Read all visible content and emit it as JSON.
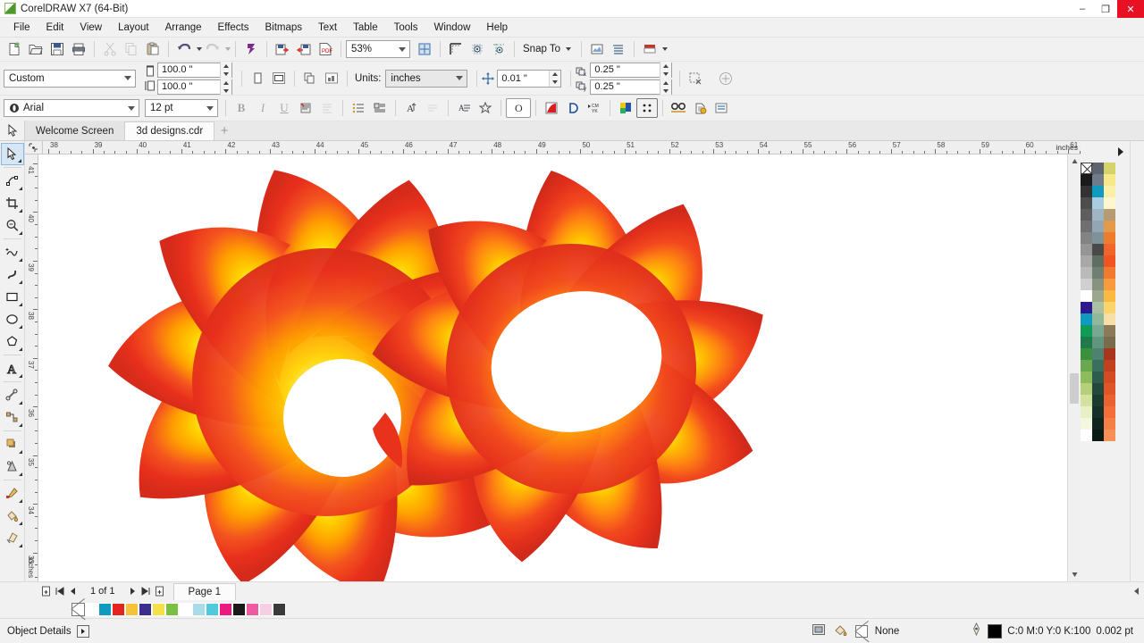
{
  "window": {
    "title": "CorelDRAW X7 (64-Bit)",
    "app_icon": "coreldraw-icon",
    "minimize": "–",
    "maximize": "❐",
    "close": "✕"
  },
  "menubar": {
    "items": [
      {
        "label": "File"
      },
      {
        "label": "Edit"
      },
      {
        "label": "View"
      },
      {
        "label": "Layout"
      },
      {
        "label": "Arrange"
      },
      {
        "label": "Effects"
      },
      {
        "label": "Bitmaps"
      },
      {
        "label": "Text"
      },
      {
        "label": "Table"
      },
      {
        "label": "Tools"
      },
      {
        "label": "Window"
      },
      {
        "label": "Help"
      }
    ]
  },
  "standard_toolbar": {
    "buttons": [
      {
        "name": "new-document",
        "title": "New"
      },
      {
        "name": "open-document",
        "title": "Open"
      },
      {
        "name": "save-document",
        "title": "Save"
      },
      {
        "name": "print-document",
        "title": "Print"
      },
      {
        "name": "cut",
        "title": "Cut"
      },
      {
        "name": "copy",
        "title": "Copy"
      },
      {
        "name": "paste",
        "title": "Paste"
      },
      {
        "name": "undo",
        "title": "Undo"
      },
      {
        "name": "redo",
        "title": "Redo"
      },
      {
        "name": "import",
        "title": "Import"
      },
      {
        "name": "export",
        "title": "Export"
      },
      {
        "name": "publish-pdf",
        "title": "Publish to PDF"
      }
    ],
    "zoom_level": "53%",
    "snap_to_label": "Snap To",
    "full_screen": "Full-Screen Preview"
  },
  "property_bar": {
    "page_preset": "Custom",
    "page_width": "100.0 \"",
    "page_height": "100.0 \"",
    "units_label": "Units:",
    "units_value": "inches",
    "nudge_offset": "0.01 \"",
    "duplicate_x": "0.25 \"",
    "duplicate_y": "0.25 \""
  },
  "text_toolbar": {
    "font_family": "Arial",
    "font_size": "12 pt",
    "bold": "B",
    "italic": "I",
    "underline": "U"
  },
  "document_tabs": {
    "tabs": [
      {
        "label": "Welcome Screen",
        "active": false
      },
      {
        "label": "3d designs.cdr",
        "active": true
      }
    ],
    "add_label": "+"
  },
  "rulers": {
    "unit_label": "inches",
    "h_start": 38,
    "h_end": 61,
    "h_ticks": [
      38,
      39,
      40,
      41,
      42,
      43,
      44,
      45,
      46,
      47,
      48,
      49,
      50,
      51,
      52,
      53,
      54,
      55,
      56,
      57,
      58,
      59,
      60,
      61
    ],
    "v_label": "inches",
    "v_ticks": [
      41,
      40,
      39,
      38,
      37,
      36,
      35,
      34,
      33
    ]
  },
  "toolbox": {
    "tools": [
      {
        "name": "pick-tool",
        "label": "Pick",
        "selected": true
      },
      {
        "name": "shape-tool",
        "label": "Shape"
      },
      {
        "name": "crop-tool",
        "label": "Crop"
      },
      {
        "name": "zoom-tool",
        "label": "Zoom"
      },
      {
        "name": "freehand-tool",
        "label": "Freehand"
      },
      {
        "name": "artistic-media-tool",
        "label": "Artistic Media"
      },
      {
        "name": "rectangle-tool",
        "label": "Rectangle"
      },
      {
        "name": "ellipse-tool",
        "label": "Ellipse"
      },
      {
        "name": "polygon-tool",
        "label": "Polygon"
      },
      {
        "name": "text-tool",
        "label": "Text"
      },
      {
        "name": "dimension-tool",
        "label": "Parallel Dimension"
      },
      {
        "name": "connector-tool",
        "label": "Straight-Line Connector"
      },
      {
        "name": "shadow-tool",
        "label": "Drop Shadow"
      },
      {
        "name": "transparency-tool",
        "label": "Transparency"
      },
      {
        "name": "color-eyedropper-tool",
        "label": "Color Eyedropper"
      },
      {
        "name": "fill-tool",
        "label": "Fill"
      },
      {
        "name": "outline-tool",
        "label": "Outline"
      }
    ]
  },
  "page_navigator": {
    "add_page_before": "Add page before",
    "first_page": "⏮",
    "prev_page": "◀",
    "page_count": "1 of 1",
    "next_page": "▶",
    "last_page": "⏭",
    "add_page_after": "Add page after",
    "page_tab": "Page 1"
  },
  "status_bar": {
    "object_details": "Object Details",
    "fill_value": "None",
    "outline_value": "C:0 M:0 Y:0 K:100",
    "outline_width": "0.002 pt"
  },
  "bottom_palette": {
    "colors": [
      "#ffffff",
      "#0f9bc0",
      "#e52421",
      "#f6c338",
      "#3b2e8c",
      "#f5e04a",
      "#7ac143",
      "#ffffff",
      "#a9dbe8",
      "#4ec9dd",
      "#ea1a7f",
      "#1a1a1a",
      "#ef5ba1",
      "#f7cfe4",
      "#3a3a3a"
    ]
  },
  "right_palette": {
    "columns": [
      [
        "#ffffff",
        "#1a1a1a",
        "#333333",
        "#4d4d4d",
        "#5e5e5e",
        "#707070",
        "#838383",
        "#969696",
        "#a8a8a8",
        "#bababa",
        "#d0d0d0",
        "#ffffff",
        "#2e1a8c",
        "#0f9bc0",
        "#0f9b58",
        "#1f7a4c",
        "#3c8f3c",
        "#6aa84f",
        "#8fbc5a",
        "#b5cf7a",
        "#d4e2a0",
        "#e9f0c8",
        "#f4f7e0",
        "#ffffff"
      ],
      [
        "#5d6470",
        "#6f7b8a",
        "#0f9bc0",
        "#a9cde0",
        "#9fb5c4",
        "#93a6b4",
        "#7f9299",
        "#4a4a4a",
        "#5f6d63",
        "#6f7f72",
        "#86937f",
        "#9aa88e",
        "#a9c0a4",
        "#8fb89c",
        "#79a892",
        "#62957f",
        "#4d8270",
        "#3a6f5e",
        "#2d5c4d",
        "#24493c",
        "#1b3a30",
        "#15302a",
        "#0f241e",
        "#0a1a15"
      ],
      [
        "#d4d46a",
        "#f5e98a",
        "#faf0a8",
        "#fdf7d0",
        "#b79b72",
        "#e39a4a",
        "#ee7d2b",
        "#f0662a",
        "#ee5521",
        "#f27a30",
        "#f79b3c",
        "#fbb93f",
        "#fdd46b",
        "#f6e0a8",
        "#8b7a58",
        "#7a6b4c",
        "#a8351c",
        "#c3401f",
        "#d44a22",
        "#e05527",
        "#ea6230",
        "#f27038",
        "#f58045",
        "#f79055"
      ]
    ]
  },
  "artwork": {
    "name": "3d-flower-designs",
    "objects": [
      {
        "name": "flower-left",
        "petals": 10,
        "center": "white",
        "gradient": [
          "#ffffff",
          "#ffd000",
          "#ff8c00",
          "#ef3a24",
          "#d42b1c"
        ]
      },
      {
        "name": "flower-right",
        "petals": 9,
        "center": "white",
        "gradient": [
          "#ffffff",
          "#ffc400",
          "#ff7f10",
          "#ea3c22",
          "#cf2a1a"
        ]
      }
    ]
  }
}
